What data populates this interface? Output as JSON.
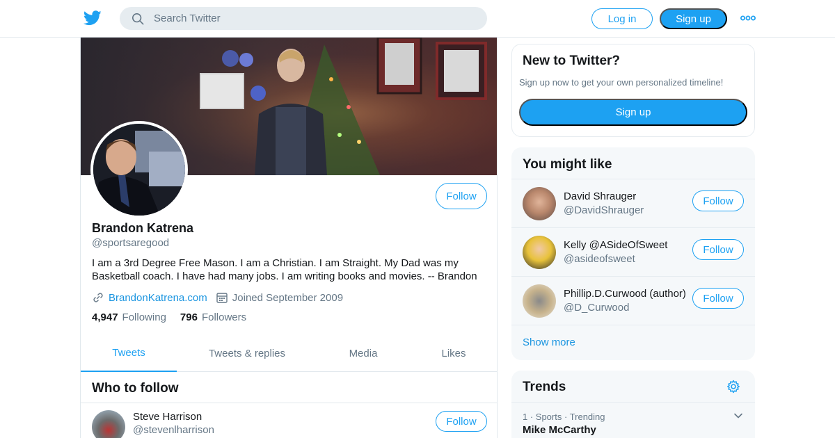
{
  "header": {
    "logo_icon": "twitter-bird-icon",
    "search_placeholder": "Search Twitter",
    "login_label": "Log in",
    "signup_label": "Sign up",
    "more_icon": "more-dots-icon"
  },
  "profile": {
    "name": "Brandon Katrena",
    "handle": "@sportsaregood",
    "follow_label": "Follow",
    "bio": "I am a 3rd Degree Free Mason. I am a Christian. I am Straight. My Dad was my Basketball coach. I have had many jobs. I am writing books and movies. -- Brandon",
    "website": "BrandonKatrena.com",
    "joined": "Joined September 2009",
    "following_count": "4,947",
    "following_label": "Following",
    "followers_count": "796",
    "followers_label": "Followers"
  },
  "tabs": [
    {
      "label": "Tweets",
      "active": true
    },
    {
      "label": "Tweets & replies",
      "active": false
    },
    {
      "label": "Media",
      "active": false
    },
    {
      "label": "Likes",
      "active": false
    }
  ],
  "who_to_follow": {
    "title": "Who to follow",
    "items": [
      {
        "name": "Steve Harrison",
        "handle": "@stevenlharrison",
        "follow_label": "Follow"
      }
    ]
  },
  "new_to_twitter": {
    "title": "New to Twitter?",
    "subtitle": "Sign up now to get your own personalized timeline!",
    "signup_label": "Sign up"
  },
  "you_might_like": {
    "title": "You might like",
    "items": [
      {
        "name": "David Shrauger",
        "handle": "@DavidShrauger",
        "follow_label": "Follow"
      },
      {
        "name": "Kelly @ASideOfSweet",
        "handle": "@asideofsweet",
        "follow_label": "Follow"
      },
      {
        "name": "Phillip.D.Curwood (author)",
        "handle": "@D_Curwood",
        "follow_label": "Follow"
      }
    ],
    "show_more": "Show more"
  },
  "trends": {
    "title": "Trends",
    "items": [
      {
        "context": "1 · Sports · Trending",
        "name": "Mike McCarthy"
      }
    ]
  },
  "colors": {
    "accent": "#1da1f2",
    "link": "#1b95e0",
    "muted_text": "#657786",
    "border": "#e1e8ed",
    "panel_bg": "#f5f8fa"
  }
}
